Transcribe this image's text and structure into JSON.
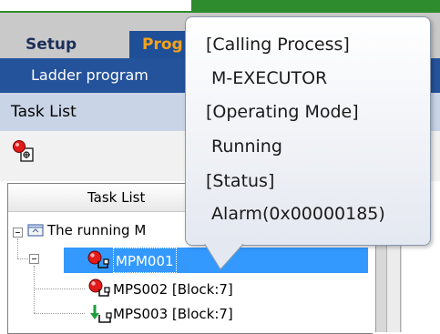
{
  "menu": {
    "tabs": [
      {
        "label": "Setup"
      },
      {
        "label": "Prog"
      }
    ],
    "submenu_label": "Ladder program"
  },
  "panel": {
    "title": "Task List",
    "toolbar_icon": "task-settings-icon"
  },
  "task_list": {
    "column_header": "Task List",
    "root": "The running M",
    "tasks": [
      {
        "label": "MPM001",
        "icon": "red-circle-task-icon",
        "selected": true
      },
      {
        "label": "MPS002 [Block:7]",
        "icon": "red-circle-task-icon"
      },
      {
        "label": "MPS003 [Block:7]",
        "icon": "green-arrow-task-icon"
      }
    ]
  },
  "tooltip": {
    "lines": [
      "[Calling Process]",
      " M-EXECUTOR",
      "[Operating Mode]",
      " Running",
      "[Status]",
      " Alarm(0x00000185)"
    ]
  },
  "colors": {
    "menu_bar": "#24529b",
    "active_tab_text": "#f4a21b",
    "selection": "#3399ff",
    "top_accent": "#2e8b2e"
  }
}
